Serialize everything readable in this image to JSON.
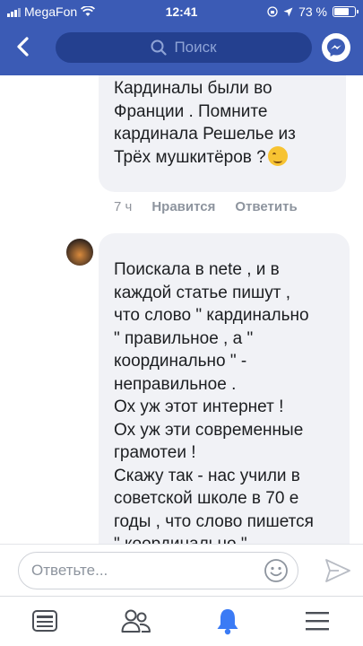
{
  "status_bar": {
    "carrier": "MegaFon",
    "time": "12:41",
    "battery": "73 %",
    "battery_level": 0.73
  },
  "header": {
    "search_placeholder": "Поиск"
  },
  "comments": [
    {
      "lines": [
        "Кардиналы были во",
        "Франции . Помните",
        "кардинала Решелье из",
        "Трёх мушкитёров ?"
      ],
      "emoji": "winking-face-icon",
      "time": "7 ч",
      "like": "Нравится",
      "reply": "Ответить"
    },
    {
      "lines": [
        "Поискала в nete , и в",
        "каждой статье пишут ,",
        "что слово \" кардинально",
        "\" правильное , а \"",
        "координально \" -",
        "неправильное .",
        "Ох уж этот интернет !",
        "Ох уж эти современные",
        "грамотеи !",
        "Скажу так - нас учили в",
        "советской школе в 70 е",
        "годы , что слово пишется",
        "\" координально \""
      ]
    }
  ],
  "composer": {
    "placeholder": "Ответьте..."
  },
  "colors": {
    "header_bg": "#3b5bb5",
    "bubble_bg": "#f1f2f6",
    "active_tab": "#3b7bf5"
  }
}
